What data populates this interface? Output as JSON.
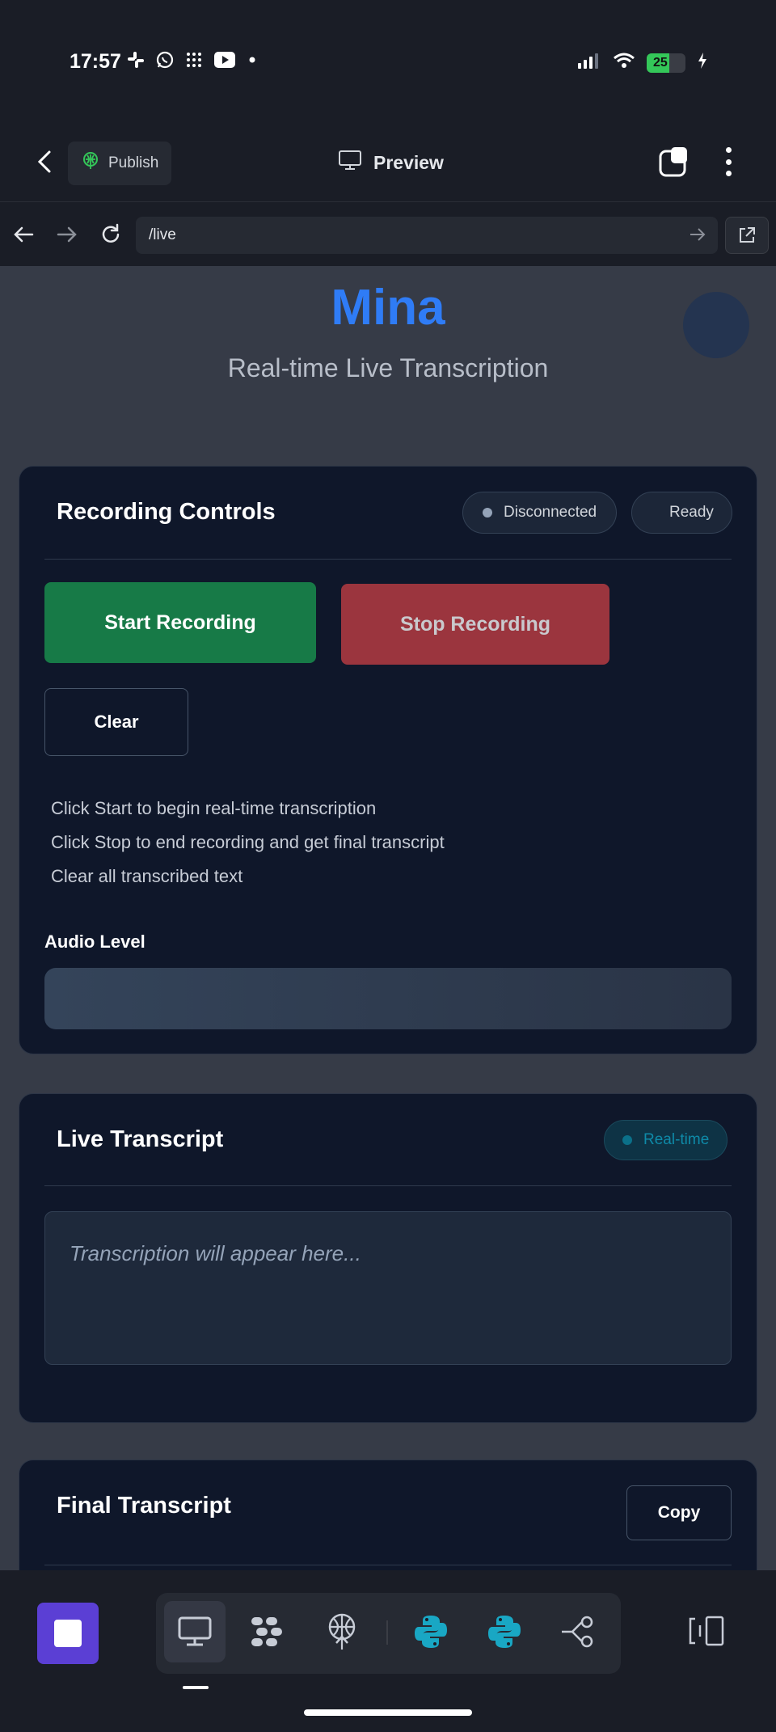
{
  "status_bar": {
    "time": "17:57",
    "battery": "25",
    "left_icons": [
      "slack-icon",
      "whatsapp-icon",
      "grid-app-icon",
      "youtube-icon",
      "dot-icon"
    ],
    "right_icons": [
      "signal-icon",
      "wifi-icon",
      "battery-icon",
      "charging-icon"
    ]
  },
  "header": {
    "publish_label": "Publish",
    "preview_label": "Preview"
  },
  "urlbar": {
    "url": "/live"
  },
  "page": {
    "brand": "Mina",
    "subtitle": "Real-time Live Transcription"
  },
  "recording": {
    "title": "Recording Controls",
    "connection_status": "Disconnected",
    "state_status": "Ready",
    "start_label": "Start Recording",
    "stop_label": "Stop Recording",
    "clear_label": "Clear",
    "hints": [
      "Click Start to begin real-time transcription",
      "Click Stop to end recording and get final transcript",
      "Clear all transcribed text"
    ],
    "audio_level_label": "Audio Level",
    "audio_level": 0
  },
  "live": {
    "title": "Live Transcript",
    "badge": "Real-time",
    "placeholder": "Transcription will appear here..."
  },
  "final": {
    "title": "Final Transcript",
    "copy_label": "Copy"
  },
  "colors": {
    "brand": "#2f7cf6",
    "start": "#177a47",
    "stop": "#9b353e",
    "card_bg": "#0f172a",
    "page_bg": "#363b47",
    "toolbar_accent": "#5b3fd4"
  }
}
